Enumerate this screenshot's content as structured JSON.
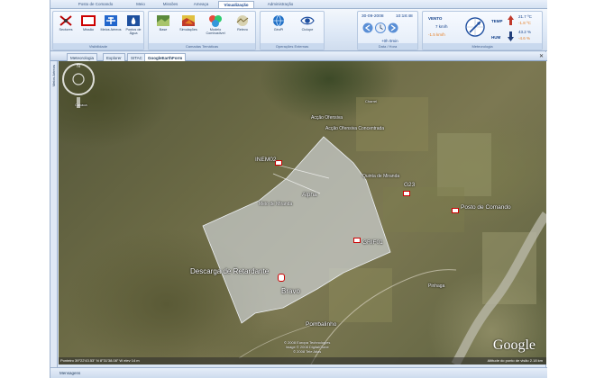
{
  "ribbon_tabs": [
    "Posto de Comando",
    "Meio",
    "Missões",
    "Ameaça",
    "Visualização",
    "Administração"
  ],
  "active_tab": "Visualização",
  "groups": {
    "visibilidade": {
      "label": "Visibilidade",
      "buttons": [
        "Sectores",
        "Missão",
        "Meios Aéreos",
        "Pontos de Água"
      ]
    },
    "camadas": {
      "label": "Camadas Temáticas",
      "buttons": [
        "Base",
        "Simulações",
        "Modelo Combustível",
        "Relevo"
      ]
    },
    "operacoes": {
      "label": "Operações Externas",
      "buttons": [
        "GéoPi",
        "Ciclope"
      ]
    },
    "datahora": {
      "label": "Data / Hora",
      "date": "30-09-2008",
      "time": "10:18:48",
      "offset": "+0h 0min"
    },
    "meteo": {
      "label": "Meteorologia",
      "vento_label": "VENTO",
      "vento_speed": "7 km/h",
      "vento_delta": "-1.5 km/h",
      "temp_label": "TEMP",
      "temp_value": "21.7 ºC",
      "temp_delta": "-1.8 ºC",
      "hum_label": "HUM",
      "hum_value": "43.2 %",
      "hum_delta": "-4.6 %"
    }
  },
  "doc_tabs": [
    "Meteorologia",
    "Explorer",
    "SITAC",
    "GoogleEarthForm"
  ],
  "active_doc_tab": "GoogleEarthForm",
  "side_strip_label": "Meios Aéreos",
  "map_labels": {
    "acao_ofensiva": "Acção Ofensiva",
    "acao_ofensiva_concentrada": "Acção Ofensiva Concentrada",
    "inem02": "INEM02",
    "quinta_miranda": "Quinta de Miranda",
    "g23": "G23",
    "alpha": "Alpha",
    "meio_miranda": "Meio de Miranda",
    "posto_comando": "Posto de Comando",
    "grif01": "GRIF01",
    "descarga": "Descarga de Retardante",
    "bravo": "Bravo",
    "pinhaga": "Pinhaga",
    "pombalinho": "Pombalinho",
    "charrel": "Charrel",
    "cavaca": "Cavaca"
  },
  "google_logo": "Google",
  "copyright": [
    "© 2008 Europa Technologies",
    "Image © 2008 DigitalGlobe",
    "© 2008 Tele Atlas"
  ],
  "status": {
    "ponteiro": "Ponteiro 39°22'43.53\" N  8°31'38.08\" W  elev   14 m",
    "altitude": "Altitude do ponto de visão  2.18 km"
  },
  "message_bar": "Mensagens",
  "colors": {
    "ribbon_bg": "#dde8f6",
    "accent": "#15428b",
    "polygon": "#d8dde4"
  }
}
